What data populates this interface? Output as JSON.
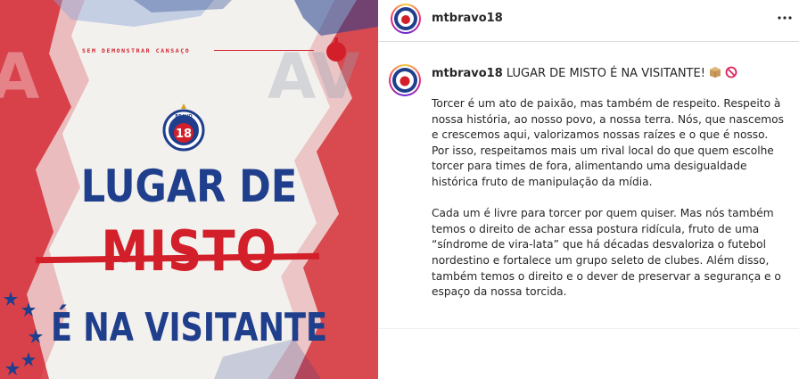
{
  "post_image": {
    "tagline": "SEM DEMONSTRAR CANSAÇO",
    "crest_text": "BRAVO",
    "crest_number": "18",
    "headline_line1": "LUGAR DE",
    "headline_line2": "MISTO",
    "headline_line3": "É NA VISITANTE",
    "colors": {
      "blue": "#1f3e8c",
      "red": "#d21f2a",
      "paper": "#f3f1ee"
    }
  },
  "post_header": {
    "username": "mtbravo18",
    "more_icon": "more-options-icon"
  },
  "caption": {
    "username": "mtbravo18",
    "title": "LUGAR DE MISTO É NA VISITANTE!",
    "emoji_icons": [
      "package-icon",
      "prohibited-icon"
    ],
    "paragraphs": [
      "Torcer é um ato de paixão, mas também de respeito. Respeito à nossa história, ao nosso povo, a nossa terra. Nós, que nascemos e crescemos aqui, valorizamos nossas raízes e o que é nosso. Por isso, respeitamos mais um rival local do que quem escolhe torcer para times de fora, alimentando uma desigualdade histórica fruto de manipulação da mídia.",
      "Cada um é livre para torcer por quem quiser. Mas nós também temos o direito de achar essa postura ridícula, fruto de uma “síndrome de vira-lata” que há décadas desvaloriza o futebol nordestino e fortalece um grupo seleto de clubes. Além disso, também temos o direito e o dever de preservar a segurança e o espaço da nossa torcida."
    ]
  }
}
